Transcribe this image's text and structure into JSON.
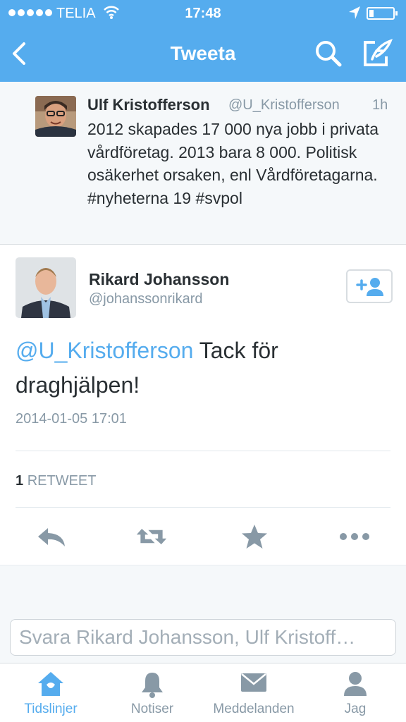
{
  "status_bar": {
    "carrier": "TELIA",
    "time": "17:48"
  },
  "nav": {
    "title": "Tweeta"
  },
  "conversation_tweet": {
    "name": "Ulf Kristofferson",
    "handle": "@U_Kristofferson",
    "time_ago": "1h",
    "text": "2012 skapades 17 000 nya jobb i privata vårdföretag. 2013 bara 8 000. Politisk osäkerhet orsaken, enl Vårdföretagarna. #nyheterna 19 #svpol"
  },
  "main_tweet": {
    "name": "Rikard Johansson",
    "handle": "@johanssonrikard",
    "mention": "@U_Kristofferson",
    "text": "Tack för draghjälpen!",
    "date": "2014-01-05 17:01",
    "retweet_count": "1",
    "retweet_label": "RETWEET"
  },
  "reply": {
    "placeholder": "Svara Rikard Johansson, Ulf Kristoff…"
  },
  "tabs": [
    {
      "label": "Tidslinjer",
      "icon": "home-icon",
      "active": true
    },
    {
      "label": "Notiser",
      "icon": "bell-icon",
      "active": false
    },
    {
      "label": "Meddelanden",
      "icon": "envelope-icon",
      "active": false
    },
    {
      "label": "Jag",
      "icon": "user-icon",
      "active": false
    }
  ],
  "colors": {
    "brand": "#55acee",
    "text": "#292f33",
    "muted": "#8899a6"
  }
}
